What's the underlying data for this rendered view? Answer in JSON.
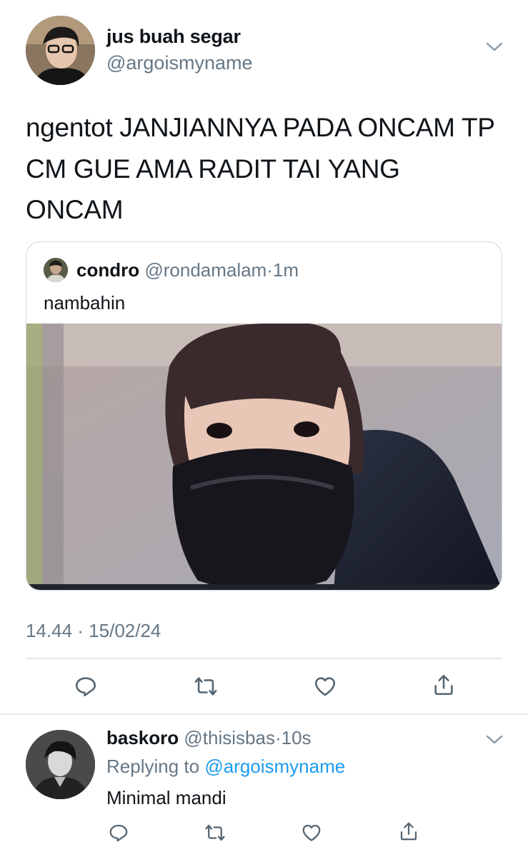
{
  "tweet": {
    "author_name": "jus buah segar",
    "author_handle": "@argoismyname",
    "text": "ngentot JANJIANNYA PADA ONCAM TP CM GUE AMA RADIT TAI YANG ONCAM",
    "timestamp": "14.44 · 15/02/24",
    "quote": {
      "author_name": "condro",
      "author_handle": "@rondamalam",
      "separator": "·",
      "time": "1m",
      "text": "nambahin"
    }
  },
  "reply": {
    "author_name": "baskoro",
    "author_handle": "@thisisbas",
    "separator": "·",
    "time": "10s",
    "replying_prefix": "Replying to",
    "replying_handle": "@argoismyname",
    "text": "Minimal mandi"
  },
  "icons": {
    "reply": "reply-icon",
    "retweet": "retweet-icon",
    "like": "heart-icon",
    "share": "share-icon",
    "more": "chevron-down-icon"
  },
  "colors": {
    "text": "#0f1419",
    "secondary": "#657786",
    "link": "#1d9bf0",
    "border": "#cfd9de"
  }
}
